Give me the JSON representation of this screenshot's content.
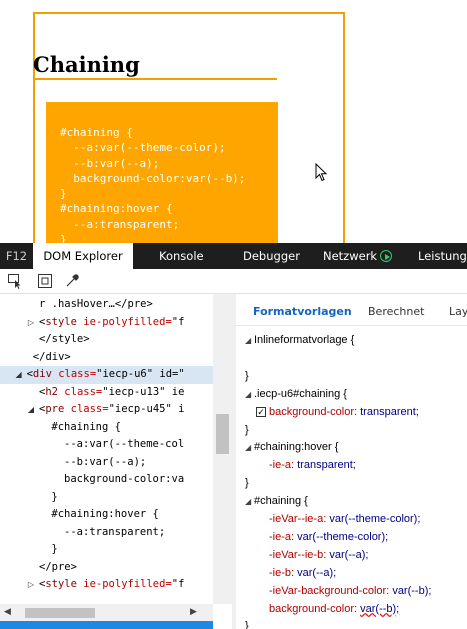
{
  "preview": {
    "heading": "Chaining",
    "code_lines": [
      "#chaining {",
      "  --a:var(--theme-color);",
      "  --b:var(--a);",
      "  background-color:var(--b);",
      "}",
      "#chaining:hover {",
      "  --a:transparent;",
      "}"
    ]
  },
  "tabs": {
    "f12": "F12",
    "dom_explorer": "DOM Explorer",
    "console": "Konsole",
    "debugger": "Debugger",
    "network": "Netzwerk",
    "performance": "Leistung"
  },
  "toolbar": {
    "icons": [
      "select-element-icon",
      "highlight-box-icon",
      "color-picker-icon"
    ]
  },
  "dom_tree": [
    {
      "indent": 5,
      "twisty": "",
      "pre": "r .hasHover…</pre>",
      "tag": "",
      "attr": "",
      "rest": ""
    },
    {
      "indent": 5,
      "twisty": "▷",
      "pre": "<",
      "tag": "style",
      "attr": " ie-polyfilled=",
      "rest": "\"f"
    },
    {
      "indent": 5,
      "twisty": "",
      "pre": "</style>",
      "tag": "",
      "attr": "",
      "rest": ""
    },
    {
      "indent": 4,
      "twisty": "",
      "pre": "</div>",
      "tag": "",
      "attr": "",
      "rest": ""
    },
    {
      "indent": 3,
      "twisty": "◢",
      "pre": "<",
      "tag": "div",
      "attr": " class=",
      "rest": "\"iecp-u6\" id=\""
    },
    {
      "indent": 5,
      "twisty": "",
      "pre": "<",
      "tag": "h2",
      "attr": " class=",
      "rest": "\"iecp-u13\" ie"
    },
    {
      "indent": 5,
      "twisty": "◢",
      "pre": "<",
      "tag": "pre",
      "attr": " class=",
      "rest": "\"iecp-u45\" i"
    },
    {
      "indent": 7,
      "twisty": "",
      "pre": "#chaining {",
      "tag": "",
      "attr": "",
      "rest": ""
    },
    {
      "indent": 7,
      "twisty": "",
      "pre": "  --a:var(--theme-col",
      "tag": "",
      "attr": "",
      "rest": ""
    },
    {
      "indent": 7,
      "twisty": "",
      "pre": "  --b:var(--a);",
      "tag": "",
      "attr": "",
      "rest": ""
    },
    {
      "indent": 7,
      "twisty": "",
      "pre": "  background-color:va",
      "tag": "",
      "attr": "",
      "rest": ""
    },
    {
      "indent": 7,
      "twisty": "",
      "pre": "}",
      "tag": "",
      "attr": "",
      "rest": ""
    },
    {
      "indent": 7,
      "twisty": "",
      "pre": "#chaining:hover {",
      "tag": "",
      "attr": "",
      "rest": ""
    },
    {
      "indent": 7,
      "twisty": "",
      "pre": "  --a:transparent;",
      "tag": "",
      "attr": "",
      "rest": ""
    },
    {
      "indent": 7,
      "twisty": "",
      "pre": "}",
      "tag": "",
      "attr": "",
      "rest": ""
    },
    {
      "indent": 5,
      "twisty": "",
      "pre": "</pre>",
      "tag": "",
      "attr": "",
      "rest": ""
    },
    {
      "indent": 5,
      "twisty": "▷",
      "pre": "<",
      "tag": "style",
      "attr": " ie-polyfilled=",
      "rest": "\"f"
    }
  ],
  "styles_tabs": {
    "styles": "Formatvorlagen",
    "computed": "Berechnet",
    "layout": "Lay"
  },
  "style_rows": [
    {
      "kind": "selector",
      "triangle": "◢",
      "text": "Inlineformatvorlage  {"
    },
    {
      "kind": "blank"
    },
    {
      "kind": "close",
      "text": "}"
    },
    {
      "kind": "selector",
      "triangle": "◢",
      "text": ".iecp-u6#chaining  {"
    },
    {
      "kind": "checkprop",
      "name": "background-color:",
      "value": "transparent;"
    },
    {
      "kind": "close",
      "text": "}"
    },
    {
      "kind": "selector",
      "triangle": "◢",
      "text": "#chaining:hover  {"
    },
    {
      "kind": "prop",
      "name": "-ie-a:",
      "value": "transparent;"
    },
    {
      "kind": "close",
      "text": "}"
    },
    {
      "kind": "selector",
      "triangle": "◢",
      "text": "#chaining  {"
    },
    {
      "kind": "prop",
      "name": "-ieVar--ie-a:",
      "value": "var(--theme-color);"
    },
    {
      "kind": "prop",
      "name": "-ie-a:",
      "value": "var(--theme-color);"
    },
    {
      "kind": "prop",
      "name": "-ieVar--ie-b:",
      "value": "var(--a);"
    },
    {
      "kind": "prop",
      "name": "-ie-b:",
      "value": "var(--a);"
    },
    {
      "kind": "prop",
      "name": "-ieVar-background-color:",
      "value": "var(--b);"
    },
    {
      "kind": "prop",
      "name": "background-color:",
      "value": "var(--b);",
      "squiggle": true
    },
    {
      "kind": "close",
      "text": "}"
    }
  ],
  "colors": {
    "accent": "#f0a000",
    "code_bg": "#ffa500",
    "tab_bar": "#1e1e1e",
    "selected_row": "#d8e6f4",
    "active_style_tab": "#1565c0",
    "prop_name": "#b00000",
    "prop_value": "#000080"
  }
}
